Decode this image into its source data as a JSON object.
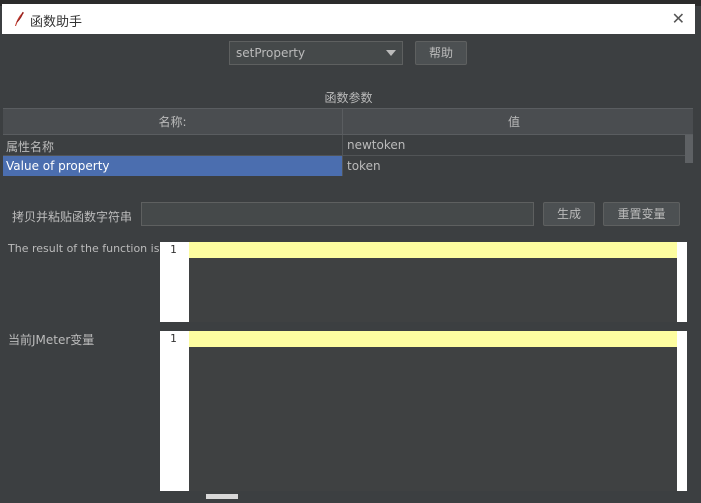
{
  "window": {
    "title": "函数助手"
  },
  "toolbar": {
    "function_selected": "setProperty",
    "help_label": "帮助"
  },
  "params": {
    "section_title": "函数参数",
    "headers": [
      "名称:",
      "值"
    ],
    "rows": [
      {
        "name": "属性名称",
        "value": "newtoken"
      },
      {
        "name": "Value of property",
        "value": "token"
      }
    ]
  },
  "paste": {
    "label": "拷贝并粘贴函数字符串",
    "value": "",
    "generate_label": "生成",
    "reset_label": "重置变量"
  },
  "result": {
    "label": "The result of the function is",
    "line_number": "1"
  },
  "vars": {
    "label": "当前JMeter变量",
    "line_number": "1"
  },
  "colors": {
    "selection": "#4b6eaf",
    "current_line": "#fdfda0",
    "background": "#3c3f41"
  }
}
